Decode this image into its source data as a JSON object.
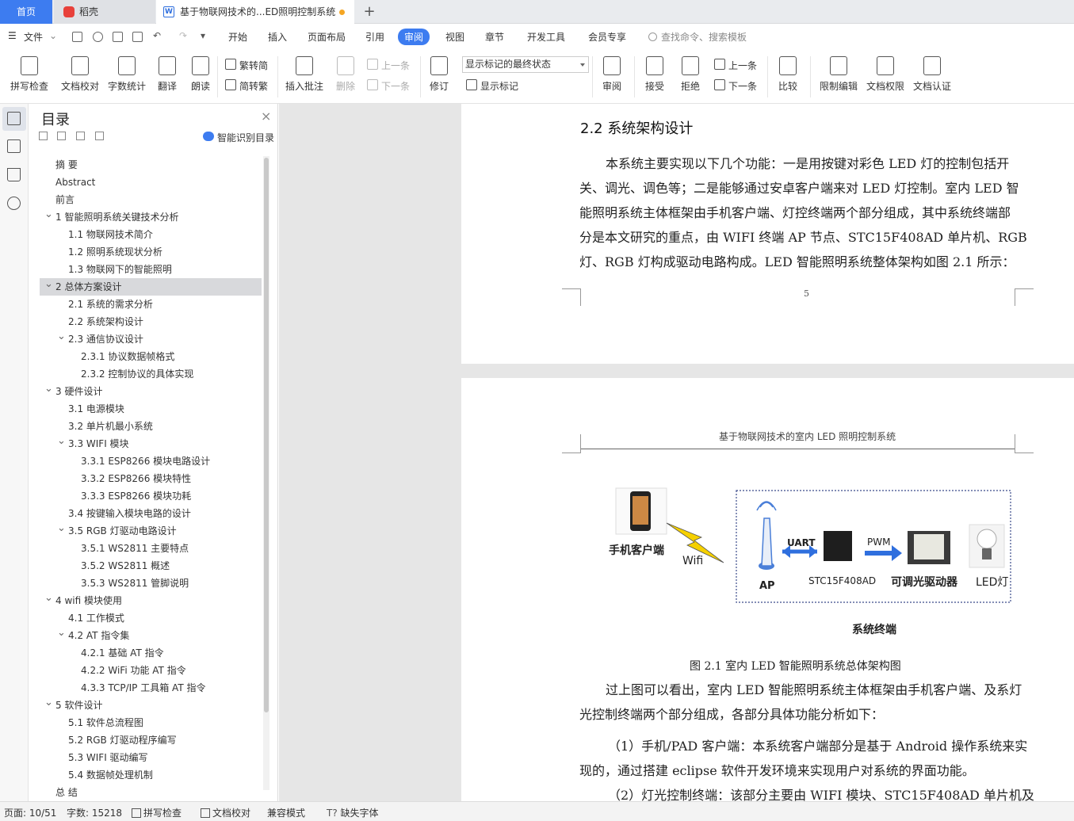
{
  "tabs": {
    "home": "首页",
    "daoke": "稻壳",
    "document": "基于物联网技术的...ED照明控制系统",
    "add": "+"
  },
  "menu": {
    "file": "文件",
    "items": [
      "开始",
      "插入",
      "页面布局",
      "引用",
      "审阅",
      "视图",
      "章节",
      "开发工具",
      "会员专享"
    ],
    "active": "审阅",
    "search_placeholder": "查找命令、搜索模板"
  },
  "ribbon": {
    "spell_check": "拼写检查",
    "doc_proof": "文档校对",
    "word_count": "字数统计",
    "translate": "翻译",
    "read_aloud": "朗读",
    "trad_to_simp": "繁转简",
    "simp_to_trad": "简转繁",
    "insert_comment": "插入批注",
    "delete": "删除",
    "prev": "上一条",
    "next": "下一条",
    "track_changes": "修订",
    "markup_state": "显示标记的最终状态",
    "show_markup": "显示标记",
    "review": "审阅",
    "accept": "接受",
    "reject": "拒绝",
    "prev2": "上一条",
    "next2": "下一条",
    "compare": "比较",
    "restrict_edit": "限制编辑",
    "doc_permission": "文档权限",
    "doc_auth": "文档认证"
  },
  "toc": {
    "title": "目录",
    "smart": "智能识别目录",
    "items": [
      {
        "text": "摘  要",
        "level": 0,
        "chev": ""
      },
      {
        "text": "Abstract",
        "level": 0,
        "chev": ""
      },
      {
        "text": "前言",
        "level": 0,
        "chev": ""
      },
      {
        "text": "1  智能照明系统关键技术分析",
        "level": 0,
        "chev": "v"
      },
      {
        "text": "1.1  物联网技术简介",
        "level": 1,
        "chev": ""
      },
      {
        "text": "1.2  照明系统现状分析",
        "level": 1,
        "chev": ""
      },
      {
        "text": "1.3  物联网下的智能照明",
        "level": 1,
        "chev": ""
      },
      {
        "text": "2  总体方案设计",
        "level": 0,
        "chev": "v",
        "selected": true
      },
      {
        "text": "2.1  系统的需求分析",
        "level": 1,
        "chev": ""
      },
      {
        "text": "2.2  系统架构设计",
        "level": 1,
        "chev": ""
      },
      {
        "text": "2.3  通信协议设计",
        "level": 1,
        "chev": "v"
      },
      {
        "text": "2.3.1 协议数据帧格式",
        "level": 2,
        "chev": ""
      },
      {
        "text": "2.3.2 控制协议的具体实现",
        "level": 2,
        "chev": ""
      },
      {
        "text": "3  硬件设计",
        "level": 0,
        "chev": "v"
      },
      {
        "text": "3.1  电源模块",
        "level": 1,
        "chev": ""
      },
      {
        "text": "3.2  单片机最小系统",
        "level": 1,
        "chev": ""
      },
      {
        "text": "3.3 WIFI 模块",
        "level": 1,
        "chev": "v"
      },
      {
        "text": "3.3.1 ESP8266 模块电路设计",
        "level": 2,
        "chev": ""
      },
      {
        "text": "3.3.2 ESP8266 模块特性",
        "level": 2,
        "chev": ""
      },
      {
        "text": "3.3.3 ESP8266 模块功耗",
        "level": 2,
        "chev": ""
      },
      {
        "text": "3.4  按键输入模块电路的设计",
        "level": 1,
        "chev": ""
      },
      {
        "text": "3.5 RGB  灯驱动电路设计",
        "level": 1,
        "chev": "v"
      },
      {
        "text": "3.5.1 WS2811 主要特点",
        "level": 2,
        "chev": ""
      },
      {
        "text": "3.5.2 WS2811 概述",
        "level": 2,
        "chev": ""
      },
      {
        "text": "3.5.3 WS2811 管脚说明",
        "level": 2,
        "chev": ""
      },
      {
        "text": "4 wifi 模块使用",
        "level": 0,
        "chev": "v"
      },
      {
        "text": "4.1  工作模式",
        "level": 1,
        "chev": ""
      },
      {
        "text": "4.2    AT 指令集",
        "level": 1,
        "chev": "v"
      },
      {
        "text": "4.2.1  基础 AT 指令",
        "level": 2,
        "chev": ""
      },
      {
        "text": "4.2.2 WiFi 功能 AT 指令",
        "level": 2,
        "chev": ""
      },
      {
        "text": "4.3.3 TCP/IP 工具箱  AT 指令",
        "level": 2,
        "chev": ""
      },
      {
        "text": "5  软件设计",
        "level": 0,
        "chev": "v"
      },
      {
        "text": "5.1  软件总流程图",
        "level": 1,
        "chev": ""
      },
      {
        "text": "5.2 RGB 灯驱动程序编写",
        "level": 1,
        "chev": ""
      },
      {
        "text": "5.3 WIFI 驱动编写",
        "level": 1,
        "chev": ""
      },
      {
        "text": "5.4  数据帧处理机制",
        "level": 1,
        "chev": ""
      },
      {
        "text": "总  结",
        "level": 0,
        "chev": ""
      }
    ]
  },
  "doc": {
    "heading": "2.2  系统架构设计",
    "para1": [
      "本系统主要实现以下几个功能：一是用按键对彩色 LED 灯的控制包括开",
      "关、调光、调色等；二是能够通过安卓客户端来对 LED 灯控制。室内 LED 智",
      "能照明系统主体框架由手机客户端、灯控终端两个部分组成，其中系统终端部",
      "分是本文研究的重点，由  WIFI 终端 AP 节点、STC15F408AD 单片机、RGB",
      "灯、RGB 灯构成驱动电路构成。LED 智能照明系统整体架构如图  2.1  所示："
    ],
    "page_number": "5",
    "page_header": "基于物联网技术的室内 LED 照明控制系统",
    "diagram": {
      "phone_label": "手机客户端",
      "wifi_label": "Wifi",
      "ap_label": "AP",
      "uart_label": "UART",
      "mcu_label": "STC15F408AD",
      "pwm_label": "PWM",
      "driver_label": "可调光驱动器",
      "led_label": "LED灯",
      "terminal_label": "系统终端"
    },
    "figure_caption": "图 2.1     室内 LED 智能照明系统总体架构图",
    "para2": [
      "过上图可以看出，室内 LED 智能照明系统主体框架由手机客户端、及系灯",
      "光控制终端两个部分组成，各部分具体功能分析如下："
    ],
    "para3": [
      "（1）手机/PAD  客户端：本系统客户端部分是基于  Android 操作系统来实",
      "现的，通过搭建  eclipse 软件开发环境来实现用户对系统的界面功能。"
    ],
    "para4": "（2）灯光控制终端：该部分主要由  WIFI 模块、STC15F408AD 单片机及"
  },
  "status": {
    "page": "页面: 10/51",
    "words": "字数: 15218",
    "spell": "拼写检查",
    "proof": "文档校对",
    "compat": "兼容模式",
    "missing_font": "缺失字体"
  },
  "colors": {
    "accent": "#3d7cf0",
    "wps_red": "#e8413b",
    "arrow_blue": "#2f6fde"
  }
}
